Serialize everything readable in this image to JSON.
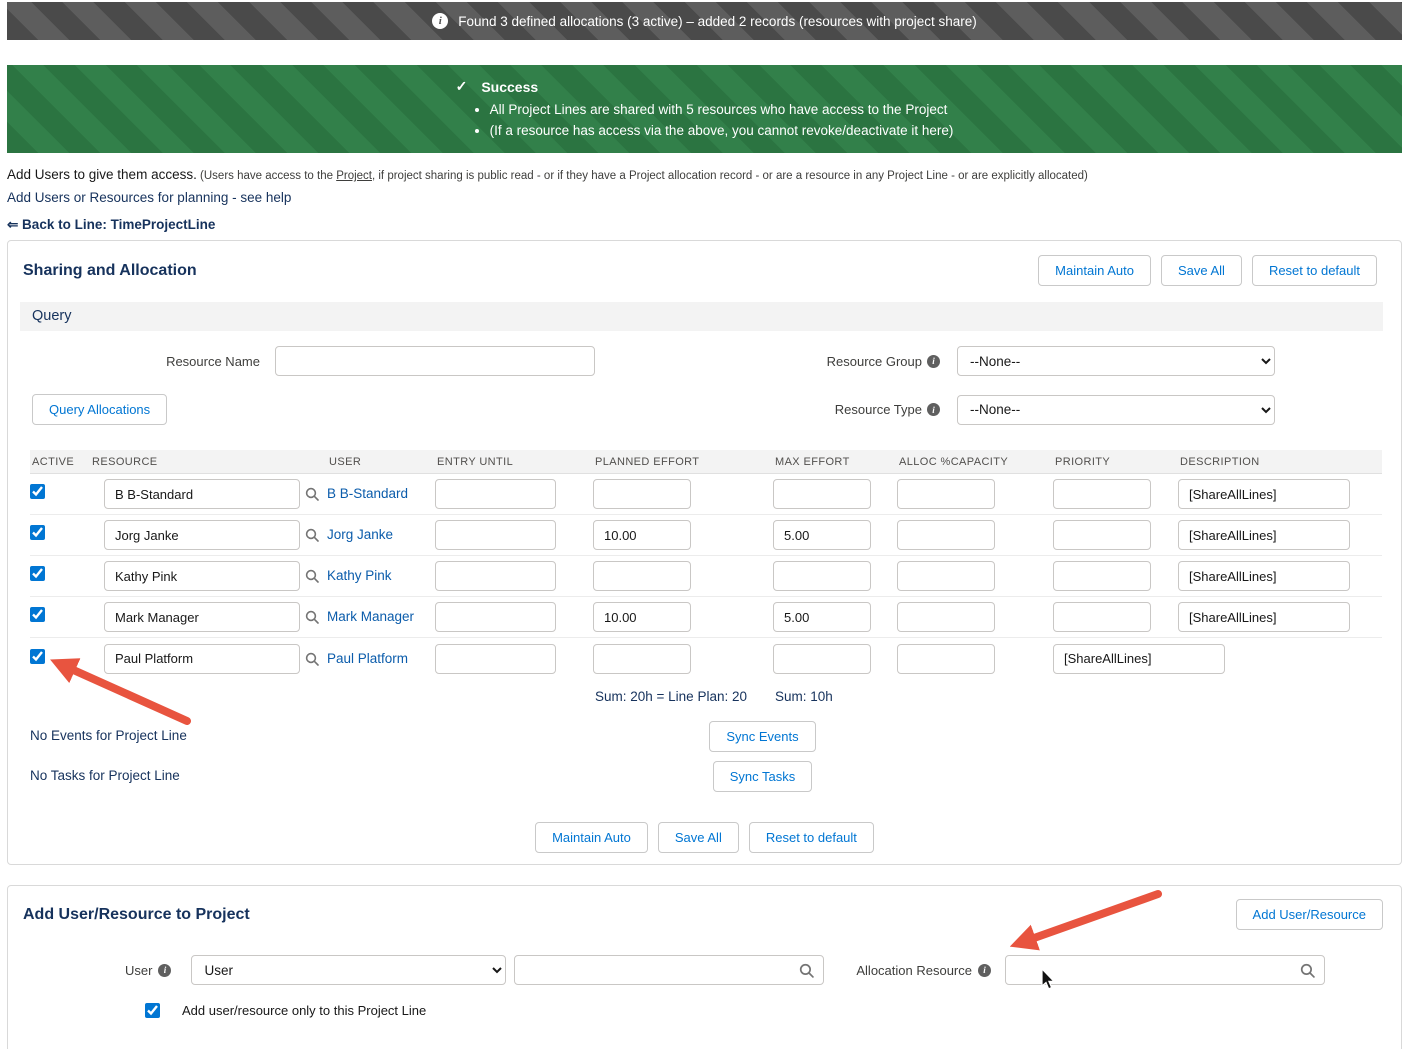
{
  "icons": {
    "info": "i",
    "check": "✓"
  },
  "colors": {
    "accent_blue": "#0176d3",
    "link_blue": "#0b5cab",
    "heading_navy": "#16325c",
    "success_green": "#2e7d46",
    "banner_gray": "#585858",
    "arrow_red": "#e8543f"
  },
  "info_banner": {
    "text": "Found 3 defined allocations (3 active) – added 2 records (resources with project share)"
  },
  "success_banner": {
    "title": "Success",
    "bullets": [
      "All Project Lines are shared with 5 resources who have access to the Project",
      "(If a resource has access via the above, you cannot revoke/deactivate it here)"
    ]
  },
  "intro": {
    "lead": "Add Users to give them access.",
    "detail_pre": " (Users have access to the ",
    "project_link": "Project",
    "detail_post": ", if project sharing is public read - or if they have a Project allocation record - or are a resource in any Project Line - or are explicitly allocated)",
    "planning": "Add Users or Resources for planning - see help",
    "back_link": "⇐ Back to Line: TimeProjectLine"
  },
  "sharing": {
    "title": "Sharing and Allocation",
    "maintain_auto": "Maintain Auto",
    "save_all": "Save All",
    "reset_default": "Reset to default",
    "query_title": "Query",
    "resource_name_label": "Resource Name",
    "resource_name_value": "",
    "resource_group_label": "Resource Group",
    "resource_group_value": "--None--",
    "resource_type_label": "Resource Type",
    "resource_type_value": "--None--",
    "query_allocations": "Query Allocations",
    "table": {
      "headers": [
        "ACTIVE",
        "RESOURCE",
        "USER",
        "ENTRY UNTIL",
        "PLANNED EFFORT",
        "MAX EFFORT",
        "ALLOC %CAPACITY",
        "PRIORITY",
        "DESCRIPTION"
      ],
      "rows": [
        {
          "active": true,
          "resource": "B B-Standard",
          "user": "B B-Standard",
          "entry_until": "",
          "planned_effort": "",
          "max_effort": "",
          "alloc_capacity": "",
          "priority": "",
          "description": "[ShareAllLines]"
        },
        {
          "active": true,
          "resource": "Jorg Janke",
          "user": "Jorg Janke",
          "entry_until": "",
          "planned_effort": "10.00",
          "max_effort": "5.00",
          "alloc_capacity": "",
          "priority": "",
          "description": "[ShareAllLines]"
        },
        {
          "active": true,
          "resource": "Kathy Pink",
          "user": "Kathy Pink",
          "entry_until": "",
          "planned_effort": "",
          "max_effort": "",
          "alloc_capacity": "",
          "priority": "",
          "description": "[ShareAllLines]"
        },
        {
          "active": true,
          "resource": "Mark Manager",
          "user": "Mark Manager",
          "entry_until": "",
          "planned_effort": "10.00",
          "max_effort": "5.00",
          "alloc_capacity": "",
          "priority": "",
          "description": "[ShareAllLines]"
        },
        {
          "active": true,
          "resource": "Paul Platform",
          "user": "Paul Platform",
          "entry_until": "",
          "planned_effort": "",
          "max_effort": "",
          "alloc_capacity": "",
          "priority": "",
          "description": "[ShareAllLines]"
        }
      ],
      "sum_planned": "Sum: 20h = Line Plan: 20",
      "sum_max": "Sum: 10h"
    },
    "no_events": "No Events for Project Line",
    "sync_events": "Sync Events",
    "no_tasks": "No Tasks for Project Line",
    "sync_tasks": "Sync Tasks"
  },
  "add_section": {
    "title": "Add User/Resource to Project",
    "add_button": "Add User/Resource",
    "user_label": "User",
    "user_select_value": "User",
    "user_search_value": "",
    "allocation_resource_label": "Allocation Resource",
    "allocation_resource_value": "",
    "only_this_line_label": "Add user/resource only to this Project Line",
    "only_this_line_checked": true
  }
}
